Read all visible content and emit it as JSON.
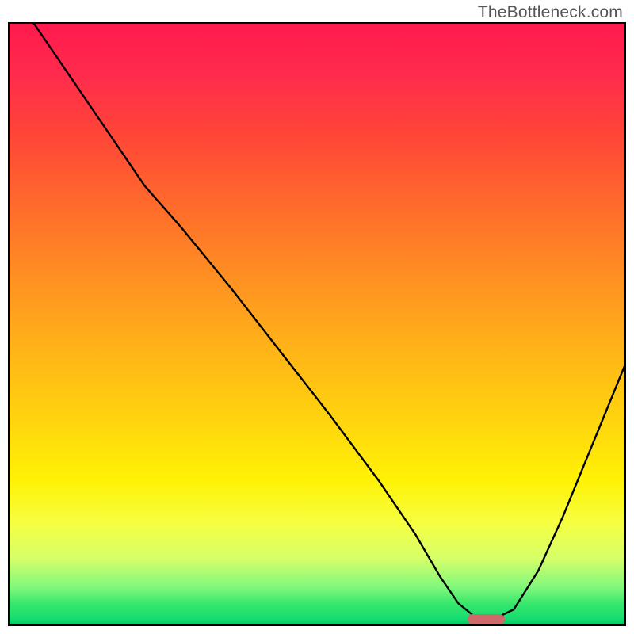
{
  "watermark": "TheBottleneck.com",
  "chart_data": {
    "type": "line",
    "title": "",
    "xlabel": "",
    "ylabel": "",
    "xlim": [
      0,
      100
    ],
    "ylim": [
      0,
      100
    ],
    "grid": false,
    "series": [
      {
        "name": "bottleneck-curve",
        "x": [
          4,
          10,
          20,
          22,
          28,
          36,
          44,
          52,
          60,
          66,
          70,
          73,
          76,
          79,
          82,
          86,
          90,
          94,
          98,
          100
        ],
        "values": [
          100,
          91,
          76,
          73,
          66,
          56,
          45.5,
          35,
          24,
          15,
          8,
          3.5,
          1,
          1,
          2.5,
          9,
          18,
          28,
          38,
          43
        ]
      }
    ],
    "gradient_stops": [
      {
        "pos": 0.0,
        "color": "#ff1a4d"
      },
      {
        "pos": 0.08,
        "color": "#ff2a4d"
      },
      {
        "pos": 0.18,
        "color": "#ff4438"
      },
      {
        "pos": 0.3,
        "color": "#ff6a2c"
      },
      {
        "pos": 0.42,
        "color": "#ff8f22"
      },
      {
        "pos": 0.54,
        "color": "#ffb318"
      },
      {
        "pos": 0.66,
        "color": "#ffd40e"
      },
      {
        "pos": 0.76,
        "color": "#fff205"
      },
      {
        "pos": 0.83,
        "color": "#f6ff40"
      },
      {
        "pos": 0.89,
        "color": "#d6ff6a"
      },
      {
        "pos": 0.94,
        "color": "#7cf77c"
      },
      {
        "pos": 0.965,
        "color": "#38e76b"
      },
      {
        "pos": 0.99,
        "color": "#17dd70"
      },
      {
        "pos": 1.0,
        "color": "#00c96a"
      }
    ],
    "marker": {
      "x_center": 77.5,
      "y": 0,
      "width_pct": 6,
      "color": "#ce6a6c"
    },
    "background": "rainbow-heat-gradient"
  }
}
